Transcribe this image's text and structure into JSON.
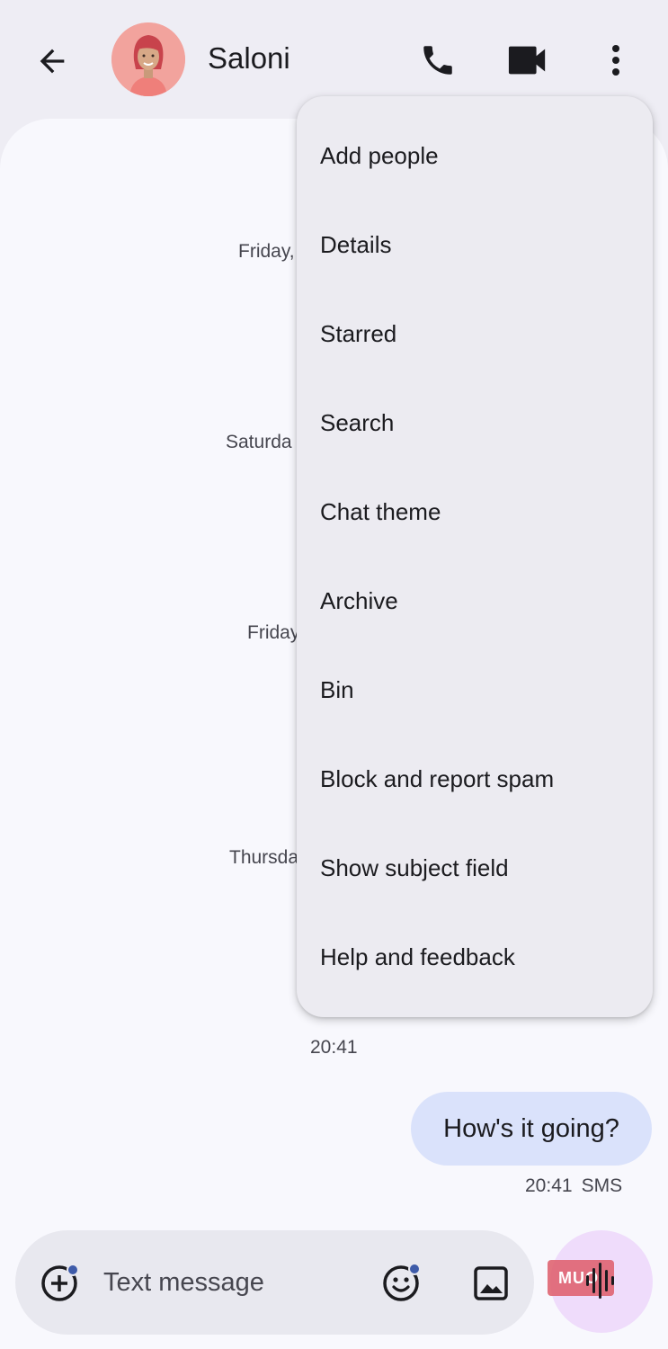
{
  "header": {
    "contact_name": "Saloni",
    "back_icon": "arrow-back-icon",
    "phone_icon": "phone-icon",
    "video_icon": "video-call-icon",
    "more_icon": "more-vert-icon"
  },
  "conversation": {
    "date_separators": [
      "Friday,",
      "Saturda",
      "Friday",
      "Thursda"
    ],
    "time_separator": "20:41",
    "message": {
      "text": "How's it going?",
      "time": "20:41",
      "type": "SMS"
    }
  },
  "composer": {
    "placeholder": "Text message",
    "add_icon": "add-circle-icon",
    "emoji_icon": "emoji-icon",
    "gallery_icon": "gallery-icon",
    "voice_icon": "voice-wave-icon",
    "watermark": "MUO"
  },
  "menu": {
    "items": [
      "Add people",
      "Details",
      "Starred",
      "Search",
      "Chat theme",
      "Archive",
      "Bin",
      "Block and report spam",
      "Show subject field",
      "Help and feedback"
    ]
  },
  "colors": {
    "background": "#eeedf4",
    "surface": "#f8f8fd",
    "bubble": "#dae2fb",
    "voice_button": "#efdcfb",
    "menu": "#ecebf1",
    "accent_dot": "#3e5ba9"
  }
}
